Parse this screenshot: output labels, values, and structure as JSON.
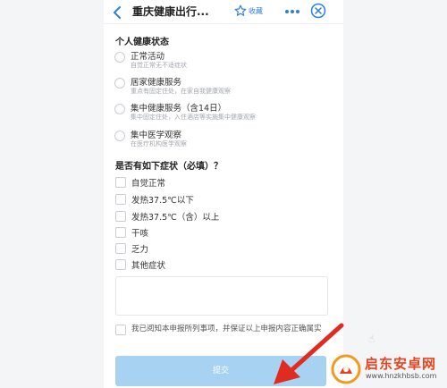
{
  "header": {
    "title": "重庆健康出行...",
    "favorite_label": "收藏"
  },
  "health_section": {
    "title": "个人健康状态",
    "options": [
      {
        "label": "正常活动",
        "desc": "自觉正常无不适症状"
      },
      {
        "label": "居家健康服务",
        "desc": "重点有固定住处，在家自我健康观察"
      },
      {
        "label": "集中健康服务（含14日）",
        "desc": "集中固定住处，入住酒店等实施集中健康观察"
      },
      {
        "label": "集中医学观察",
        "desc": "在医疗机构医学观察"
      }
    ]
  },
  "symptom_section": {
    "title": "是否有如下症状（必填）？",
    "options": [
      "自觉正常",
      "发热37.5℃以下",
      "发热37.5℃（含）以上",
      "干咳",
      "乏力",
      "其他症状"
    ]
  },
  "agreement": {
    "text": "我已阅知本申报所列事项，并保证以上申报内容正确属实"
  },
  "submit_label": "提交",
  "watermark": {
    "text": "启东安卓网",
    "url": "www.hnzkhbsb.com"
  },
  "colors": {
    "accent": "#2f7fd6",
    "submit": "#a7d2f2",
    "arrow": "#e02b20",
    "watermark": "#e8431f"
  }
}
